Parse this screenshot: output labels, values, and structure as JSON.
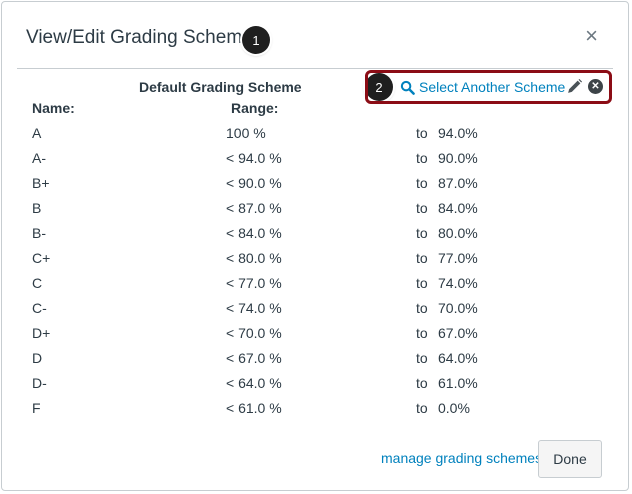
{
  "dialog": {
    "title": "View/Edit Grading Scheme",
    "close_symbol": "×",
    "callouts": [
      "1",
      "2"
    ]
  },
  "scheme": {
    "title": "Default Grading Scheme",
    "name_header": "Name:",
    "range_header": "Range:",
    "select_link": "Select Another Scheme",
    "rows": [
      {
        "name": "A",
        "range": "100 %",
        "to": "to",
        "min": "94.0%"
      },
      {
        "name": "A-",
        "range": "< 94.0 %",
        "to": "to",
        "min": "90.0%"
      },
      {
        "name": "B+",
        "range": "< 90.0 %",
        "to": "to",
        "min": "87.0%"
      },
      {
        "name": "B",
        "range": "< 87.0 %",
        "to": "to",
        "min": "84.0%"
      },
      {
        "name": "B-",
        "range": "< 84.0 %",
        "to": "to",
        "min": "80.0%"
      },
      {
        "name": "C+",
        "range": "< 80.0 %",
        "to": "to",
        "min": "77.0%"
      },
      {
        "name": "C",
        "range": "< 77.0 %",
        "to": "to",
        "min": "74.0%"
      },
      {
        "name": "C-",
        "range": "< 74.0 %",
        "to": "to",
        "min": "70.0%"
      },
      {
        "name": "D+",
        "range": "< 70.0 %",
        "to": "to",
        "min": "67.0%"
      },
      {
        "name": "D",
        "range": "< 67.0 %",
        "to": "to",
        "min": "64.0%"
      },
      {
        "name": "D-",
        "range": "< 64.0 %",
        "to": "to",
        "min": "61.0%"
      },
      {
        "name": "F",
        "range": "< 61.0 %",
        "to": "to",
        "min": "0.0%"
      }
    ]
  },
  "footer": {
    "manage_link": "manage grading schemes",
    "done_label": "Done"
  },
  "icons": {
    "search": "search-icon",
    "pencil": "pencil-icon",
    "remove": "close-circle-icon",
    "close": "close-icon"
  },
  "colors": {
    "link": "#0081bd",
    "callout_border": "#8b0c15",
    "text": "#2d3b45"
  }
}
